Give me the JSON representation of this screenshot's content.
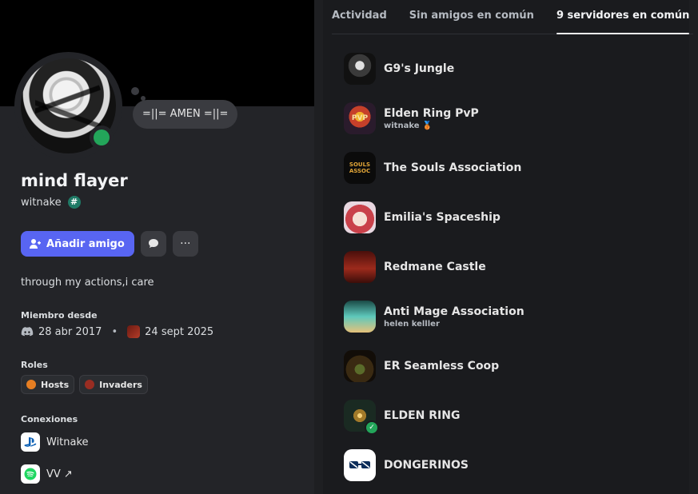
{
  "profile": {
    "status_text": "=||= AMEN =||=",
    "display_name": "mind flayer",
    "username": "witnake",
    "badge_symbol": "#",
    "add_friend_label": "Añadir amigo",
    "more_label": "···",
    "bio": "through my actions,i care",
    "member_since_title": "Miembro desde",
    "discord_date": "28 abr 2017",
    "server_date": "24 sept 2025",
    "roles_title": "Roles",
    "roles": [
      {
        "label": "Hosts",
        "color": "#e67e22"
      },
      {
        "label": "Invaders",
        "color": "#992d22"
      }
    ],
    "connections_title": "Conexiones",
    "connections": [
      {
        "label": "Witnake",
        "icon": "playstation-icon"
      },
      {
        "label": "VV ↗",
        "icon": "spotify-icon"
      }
    ],
    "status_color": "#23a55a",
    "accent": "#5865f2"
  },
  "tabs": [
    {
      "label": "Actividad",
      "active": false
    },
    {
      "label": "Sin amigos en común",
      "active": false
    },
    {
      "label": "9 servidores en común",
      "active": true
    }
  ],
  "servers": [
    {
      "name": "G9's Jungle",
      "sub": ""
    },
    {
      "name": "Elden Ring PvP",
      "sub": "witnake 🥉"
    },
    {
      "name": "The Souls Association",
      "sub": ""
    },
    {
      "name": "Emilia's Spaceship",
      "sub": ""
    },
    {
      "name": "Redmane Castle",
      "sub": ""
    },
    {
      "name": "Anti Mage Association",
      "sub": "helen kelller"
    },
    {
      "name": "ER Seamless Coop",
      "sub": ""
    },
    {
      "name": "ELDEN RING",
      "sub": ""
    },
    {
      "name": "DONGERINOS",
      "sub": ""
    }
  ]
}
